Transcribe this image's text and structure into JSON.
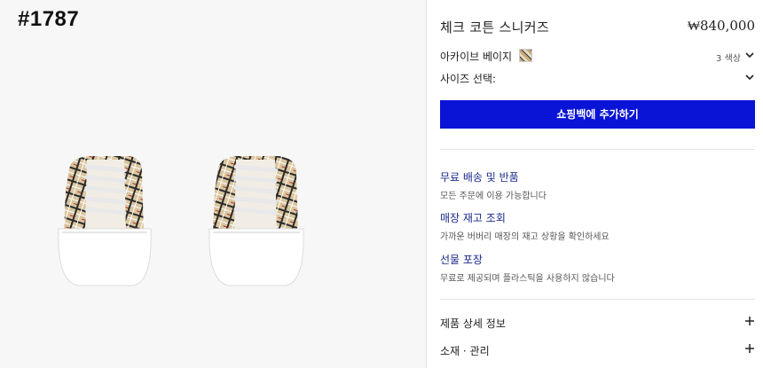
{
  "overlay_tag": "#1787",
  "product": {
    "title": "체크 코튼 스니커즈",
    "price": "₩840,000",
    "color_label": "아카이브 베이지",
    "color_count": "3 색상",
    "size_label": "사이즈 선택:",
    "add_to_bag": "쇼핑백에 추가하기"
  },
  "info": [
    {
      "title": "무료 배송 및 반품",
      "sub": "모든 주문에 이용 가능합니다"
    },
    {
      "title": "매장 재고 조회",
      "sub": "가까운 버버리 매장의 재고 상황을 확인하세요"
    },
    {
      "title": "선물 포장",
      "sub": "무료로 제공되며 플라스틱을 사용하지 않습니다"
    }
  ],
  "accordion": [
    {
      "label": "제품 상세 정보"
    },
    {
      "label": "소재 · 관리"
    }
  ],
  "colors": {
    "accent": "#0a14d6",
    "info_link": "#1a2a8a"
  }
}
